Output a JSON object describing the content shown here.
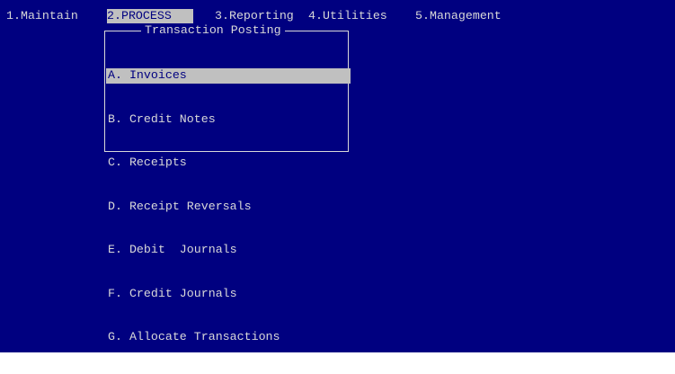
{
  "colors": {
    "background": "#000080",
    "text": "#d8d8d8",
    "highlight_background": "#c0c0c0",
    "highlight_text": "#000080"
  },
  "menubar": {
    "items": [
      {
        "label": "1.Maintain"
      },
      {
        "label": "2.PROCESS",
        "selected": true
      },
      {
        "label": "3.Reporting"
      },
      {
        "label": "4.Utilities"
      },
      {
        "label": "5.Management"
      }
    ]
  },
  "popup": {
    "title": "Transaction Posting",
    "items": [
      {
        "label": "A. Invoices",
        "selected": true
      },
      {
        "label": "B. Credit Notes"
      },
      {
        "label": "C. Receipts"
      },
      {
        "label": "D. Receipt Reversals"
      },
      {
        "label": "E. Debit  Journals"
      },
      {
        "label": "F. Credit Journals"
      },
      {
        "label": "G. Allocate Transactions"
      }
    ]
  }
}
